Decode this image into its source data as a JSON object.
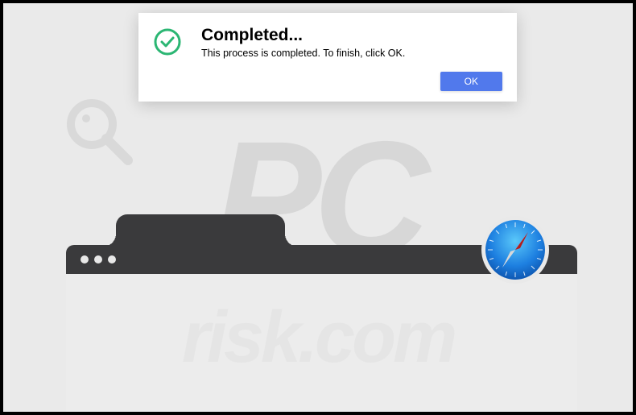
{
  "watermark": {
    "main": "PC",
    "sub": "risk.com"
  },
  "dialog": {
    "title": "Completed...",
    "message": "This process is completed. To finish, click OK.",
    "button_label": "OK"
  }
}
